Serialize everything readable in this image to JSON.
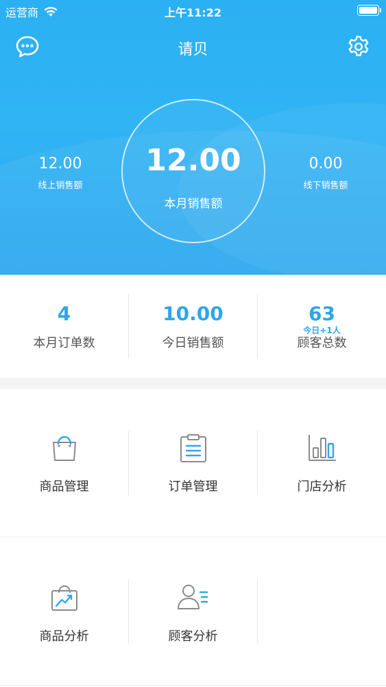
{
  "status_bar": {
    "carrier": "运营商",
    "time": "上午11:22"
  },
  "nav": {
    "title": "请贝",
    "left_icon": "chat-bubble-icon",
    "right_icon": "gear-icon"
  },
  "hero": {
    "monthly_sales_value": "12.00",
    "monthly_sales_label": "本月销售额",
    "online_sales_value": "12.00",
    "online_sales_label": "线上销售额",
    "offline_sales_value": "0.00",
    "offline_sales_label": "线下销售额"
  },
  "stats": [
    {
      "value": "4",
      "label": "本月订单数",
      "sub": ""
    },
    {
      "value": "10.00",
      "label": "今日销售额",
      "sub": ""
    },
    {
      "value": "63",
      "label": "顾客总数",
      "sub": "今日+1人"
    }
  ],
  "menu": [
    {
      "label": "商品管理",
      "icon": "shopping-bag-icon"
    },
    {
      "label": "订单管理",
      "icon": "clipboard-list-icon"
    },
    {
      "label": "门店分析",
      "icon": "bar-chart-icon"
    },
    {
      "label": "商品分析",
      "icon": "bag-trend-icon"
    },
    {
      "label": "顾客分析",
      "icon": "user-list-icon"
    }
  ],
  "colors": {
    "brand_blue": "#2bb0f3",
    "accent_blue": "#2ea6ea",
    "icon_gray": "#8a8a8a"
  }
}
